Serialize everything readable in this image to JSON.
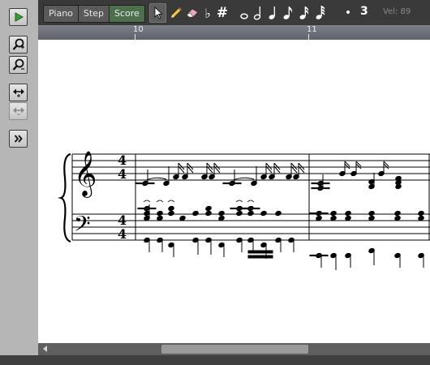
{
  "left_toolbar": {
    "buttons": [
      {
        "name": "play-button",
        "icon": "play-icon"
      },
      {
        "name": "zoom-in-button",
        "icon": "zoom-in-icon"
      },
      {
        "name": "zoom-out-button",
        "icon": "zoom-out-icon"
      },
      {
        "name": "expand-width-button",
        "icon": "expand-horizontal-icon"
      },
      {
        "name": "shrink-width-button",
        "icon": "shrink-horizontal-icon",
        "disabled": true
      },
      {
        "name": "more-button",
        "icon": "double-chevron-right-icon"
      }
    ]
  },
  "toolbar": {
    "tabs": [
      "Piano",
      "Step",
      "Score"
    ],
    "active_tab": "Score",
    "tools": [
      "select-arrow-icon",
      "pencil-icon",
      "eraser-icon"
    ],
    "accidentals": {
      "flat": "♭",
      "sharp": "#"
    },
    "note_values": [
      "whole-note-icon",
      "half-note-icon",
      "quarter-note-icon",
      "eighth-note-icon",
      "sixteenth-note-icon",
      "thirty-second-note-icon"
    ],
    "dot": "•",
    "triplet": "3",
    "velocity": "Vel: 89"
  },
  "ruler": {
    "marks": [
      "10",
      "11"
    ]
  },
  "score": {
    "time_signature": {
      "top": "4",
      "bottom": "4"
    },
    "clefs": {
      "treble": "𝄞",
      "bass": "𝄢"
    }
  },
  "colors": {
    "active_tab": "#4d6f4b",
    "play_green": "#3a9a3a",
    "toolbar_bg": "#3a3a3a",
    "ruler_bg": "#6e7179"
  }
}
